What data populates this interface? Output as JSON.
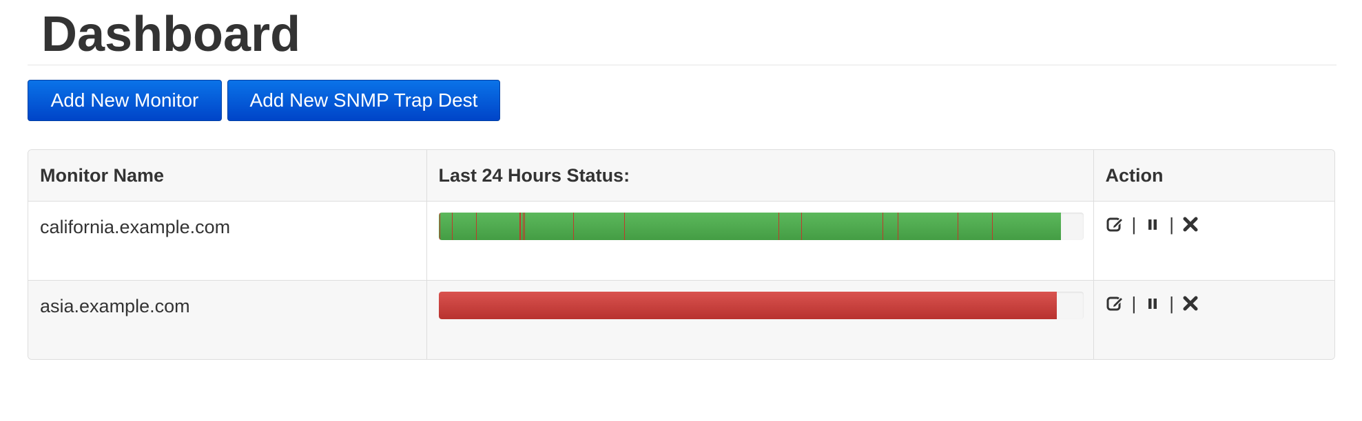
{
  "header": {
    "title": "Dashboard"
  },
  "toolbar": {
    "add_monitor_label": "Add New Monitor",
    "add_snmp_label": "Add New SNMP Trap Dest"
  },
  "table": {
    "columns": [
      "Monitor Name",
      "Last 24 Hours Status:",
      "Action"
    ],
    "rows": [
      {
        "name": "california.example.com",
        "status": {
          "color": "#5cb85c",
          "fraction": 0.965,
          "failure_marks": [
            0.002,
            0.021,
            0.058,
            0.125,
            0.127,
            0.131,
            0.133,
            0.209,
            0.288,
            0.527,
            0.563,
            0.689,
            0.712,
            0.805,
            0.858
          ]
        },
        "actions": {
          "edit_icon": "edit-icon",
          "separator": "|",
          "pause_icon": "pause-icon",
          "delete_icon": "close-icon"
        }
      },
      {
        "name": "asia.example.com",
        "status": {
          "color": "#d9534f",
          "fraction": 0.959,
          "failure_marks": []
        },
        "actions": {
          "edit_icon": "edit-icon",
          "separator": "|",
          "pause_icon": "pause-icon",
          "delete_icon": "close-icon"
        }
      }
    ]
  }
}
